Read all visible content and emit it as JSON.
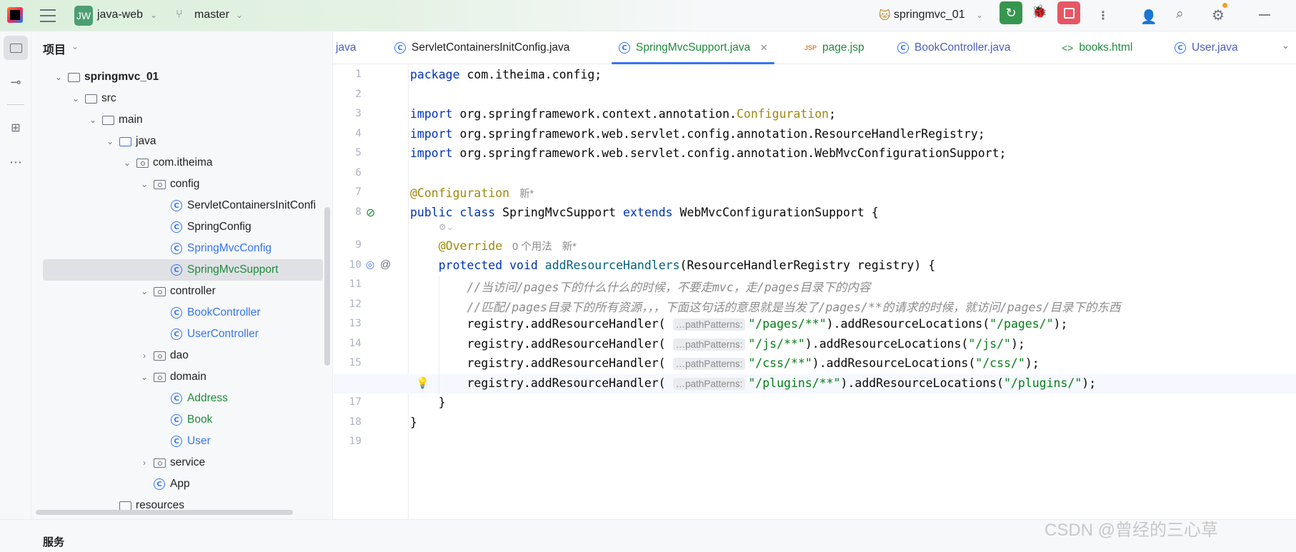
{
  "topbar": {
    "project_badge": "JW",
    "project": "java-web",
    "branch": "master",
    "run_config": "springmvc_01"
  },
  "project_panel": {
    "title": "项目"
  },
  "tree": [
    {
      "label": "springmvc_01",
      "level": 0,
      "type": "module",
      "state": "open",
      "bold": true
    },
    {
      "label": "src",
      "level": 1,
      "type": "folder",
      "state": "open"
    },
    {
      "label": "main",
      "level": 2,
      "type": "folder",
      "state": "open"
    },
    {
      "label": "java",
      "level": 3,
      "type": "srcfolder",
      "state": "open"
    },
    {
      "label": "com.itheima",
      "level": 4,
      "type": "package",
      "state": "open"
    },
    {
      "label": "config",
      "level": 5,
      "type": "package",
      "state": "open"
    },
    {
      "label": "ServletContainersInitConfi",
      "level": 6,
      "type": "class",
      "color": "#1e1f22"
    },
    {
      "label": "SpringConfig",
      "level": 6,
      "type": "class",
      "color": "#1e1f22"
    },
    {
      "label": "SpringMvcConfig",
      "level": 6,
      "type": "class",
      "color": "#3574f0"
    },
    {
      "label": "SpringMvcSupport",
      "level": 6,
      "type": "class",
      "color": "#208a3c",
      "selected": true
    },
    {
      "label": "controller",
      "level": 5,
      "type": "package",
      "state": "open"
    },
    {
      "label": "BookController",
      "level": 6,
      "type": "class",
      "color": "#3574f0"
    },
    {
      "label": "UserController",
      "level": 6,
      "type": "class",
      "color": "#3574f0"
    },
    {
      "label": "dao",
      "level": 5,
      "type": "package",
      "state": "closed"
    },
    {
      "label": "domain",
      "level": 5,
      "type": "package",
      "state": "open"
    },
    {
      "label": "Address",
      "level": 6,
      "type": "class",
      "color": "#208a3c"
    },
    {
      "label": "Book",
      "level": 6,
      "type": "class",
      "color": "#208a3c"
    },
    {
      "label": "User",
      "level": 6,
      "type": "class",
      "color": "#3574f0"
    },
    {
      "label": "service",
      "level": 5,
      "type": "package",
      "state": "closed"
    },
    {
      "label": "App",
      "level": 5,
      "type": "class",
      "color": "#1e1f22"
    },
    {
      "label": "resources",
      "level": 3,
      "type": "folder"
    }
  ],
  "tabs": [
    {
      "label": "java",
      "icon": "none",
      "color": "#4a5fc1"
    },
    {
      "label": "ServletContainersInitConfig.java",
      "icon": "class",
      "color": "#1e1f22"
    },
    {
      "label": "SpringMvcSupport.java",
      "icon": "class",
      "color": "#208a3c",
      "active": true
    },
    {
      "label": "page.jsp",
      "icon": "jsp",
      "color": "#208a3c"
    },
    {
      "label": "BookController.java",
      "icon": "class",
      "color": "#4a5fc1"
    },
    {
      "label": "books.html",
      "icon": "html",
      "color": "#208a3c"
    },
    {
      "label": "User.java",
      "icon": "class",
      "color": "#4a5fc1"
    }
  ],
  "code": [
    [
      [
        "kw",
        "package "
      ],
      [
        "",
        "com.itheima.config;"
      ]
    ],
    [],
    [
      [
        "kw",
        "import "
      ],
      [
        "",
        "org.springframework.context.annotation."
      ],
      [
        "an",
        "Configuration"
      ],
      [
        "",
        ";"
      ]
    ],
    [
      [
        "kw",
        "import "
      ],
      [
        "",
        "org.springframework.web.servlet.config.annotation.ResourceHandlerRegistry;"
      ]
    ],
    [
      [
        "kw",
        "import "
      ],
      [
        "",
        "org.springframework.web.servlet.config.annotation.WebMvcConfigurationSupport;"
      ]
    ],
    [],
    [
      [
        "an",
        "@Configuration"
      ],
      [
        "vis",
        "新*"
      ]
    ],
    [
      [
        "kw",
        "public class "
      ],
      [
        "",
        "SpringMvcSupport "
      ],
      [
        "kw",
        "extends "
      ],
      [
        "",
        "WebMvcConfigurationSupport {"
      ]
    ],
    [
      [
        "",
        "    "
      ],
      [
        "an",
        "@Override"
      ],
      [
        "vis",
        "0 个用法"
      ],
      [
        "vis",
        "新*"
      ]
    ],
    [
      [
        "",
        "    "
      ],
      [
        "kw",
        "protected void "
      ],
      [
        "fn",
        "addResourceHandlers"
      ],
      [
        "",
        "(ResourceHandlerRegistry registry) {"
      ]
    ],
    [
      [
        "",
        "        "
      ],
      [
        "cm",
        "//当访问/pages下的什么什么的时候，不要走mvc，走/pages目录下的内容"
      ]
    ],
    [
      [
        "",
        "        "
      ],
      [
        "cm",
        "//匹配/pages目录下的所有资源，，，下面这句话的意思就是当发了/pages/**的请求的时候，就访问/pages/目录下的东西"
      ]
    ],
    [
      [
        "",
        "        registry.addResourceHandler( "
      ],
      [
        "hint",
        "…pathPatterns:"
      ],
      [
        "st",
        "\"/pages/**\""
      ],
      [
        "",
        ").addResourceLocations("
      ],
      [
        "st",
        "\"/pages/\""
      ],
      [
        "",
        ");"
      ]
    ],
    [
      [
        "",
        "        registry.addResourceHandler( "
      ],
      [
        "hint",
        "…pathPatterns:"
      ],
      [
        "st",
        "\"/js/**\""
      ],
      [
        "",
        ").addResourceLocations("
      ],
      [
        "st",
        "\"/js/\""
      ],
      [
        "",
        ");"
      ]
    ],
    [
      [
        "",
        "        registry.addResourceHandler( "
      ],
      [
        "hint",
        "…pathPatterns:"
      ],
      [
        "st",
        "\"/css/**\""
      ],
      [
        "",
        ").addResourceLocations("
      ],
      [
        "st",
        "\"/css/\""
      ],
      [
        "",
        ");"
      ]
    ],
    [
      [
        "",
        "        registry.addResourceHandler( "
      ],
      [
        "hint",
        "…pathPatterns:"
      ],
      [
        "st",
        "\"/plugins/**\""
      ],
      [
        "",
        ").addResourceLocations("
      ],
      [
        "st",
        "\"/plugins/\""
      ],
      [
        "",
        ");"
      ]
    ],
    [
      [
        "",
        "    }"
      ]
    ],
    [
      [
        "",
        "}"
      ]
    ],
    []
  ],
  "current_line": 16,
  "bottom": {
    "services": "服务"
  },
  "watermark": "CSDN @曾经的三心草"
}
